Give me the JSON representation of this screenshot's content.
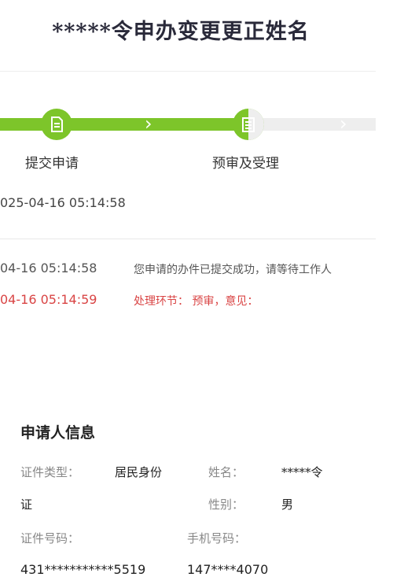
{
  "header": {
    "title": "*****令申办变更更正姓名"
  },
  "stepper": {
    "steps": [
      {
        "label": "提交申请",
        "state": "done"
      },
      {
        "label": "预审及受理",
        "state": "active"
      }
    ],
    "submit_time": "025-04-16 05:14:58",
    "colors": {
      "done": "#7dc52a",
      "pending": "#eeeeee"
    }
  },
  "log": [
    {
      "time": "04-16 05:14:58",
      "message": "您申请的办件已提交成功，请等待工作人"
    },
    {
      "time": "04-16 05:14:59",
      "message": "处理环节： 预审，意见："
    }
  ],
  "applicant": {
    "section_title": "申请人信息",
    "id_type_label": "证件类型：",
    "id_type_value_line1": "居民身份",
    "id_type_value_line2": "证",
    "name_label": "姓名：",
    "name_value": "*****令",
    "gender_label": "性别：",
    "gender_value": "男",
    "id_number_label": "证件号码：",
    "id_number_value": "431***********5519",
    "phone_label": "手机号码：",
    "phone_value": "147****4070"
  }
}
